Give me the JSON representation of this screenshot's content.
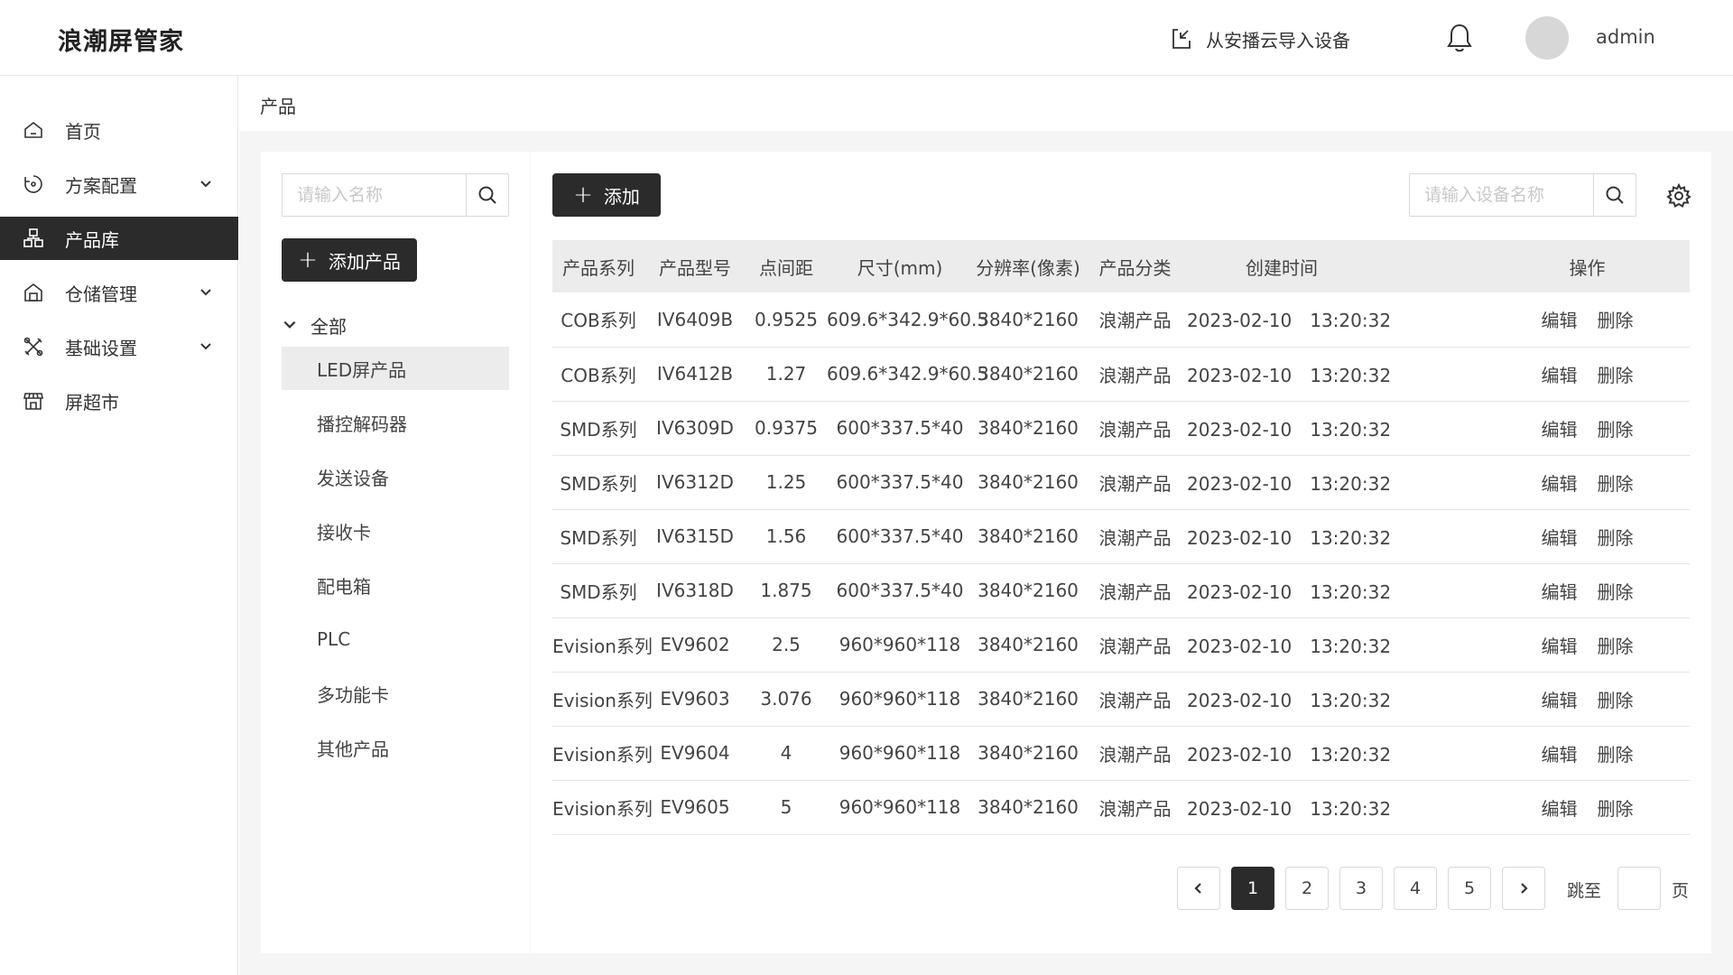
{
  "app": {
    "title": "浪潮屏管家"
  },
  "header": {
    "import_label": "从安播云导入设备",
    "username": "admin"
  },
  "sidebar": {
    "items": [
      {
        "label": "首页",
        "icon": "home-icon",
        "expandable": false
      },
      {
        "label": "方案配置",
        "icon": "scheme-icon",
        "expandable": true
      },
      {
        "label": "产品库",
        "icon": "product-library-icon",
        "expandable": false,
        "active": true
      },
      {
        "label": "仓储管理",
        "icon": "warehouse-icon",
        "expandable": true
      },
      {
        "label": "基础设置",
        "icon": "tools-icon",
        "expandable": true
      },
      {
        "label": "屏超市",
        "icon": "store-icon",
        "expandable": false
      }
    ]
  },
  "breadcrumb": "产品",
  "left_panel": {
    "search_placeholder": "请输入名称",
    "add_product_label": "添加产品",
    "tree_root": "全部",
    "categories": [
      "LED屏产品",
      "播控解码器",
      "发送设备",
      "接收卡",
      "配电箱",
      "PLC",
      "多功能卡",
      "其他产品"
    ],
    "selected_index": 0
  },
  "right_panel": {
    "add_label": "添加",
    "search_placeholder": "请输入设备名称"
  },
  "table": {
    "columns": [
      "产品系列",
      "产品型号",
      "点间距",
      "尺寸(mm)",
      "分辨率(像素)",
      "产品分类",
      "创建时间",
      "操作"
    ],
    "edit_label": "编辑",
    "delete_label": "删除",
    "rows": [
      [
        "COB系列",
        "IV6409B",
        "0.9525",
        "609.6*342.9*60.5",
        "3840*2160",
        "浪潮产品",
        "2023-02-10　13:20:32"
      ],
      [
        "COB系列",
        "IV6412B",
        "1.27",
        "609.6*342.9*60.5",
        "3840*2160",
        "浪潮产品",
        "2023-02-10　13:20:32"
      ],
      [
        "SMD系列",
        "IV6309D",
        "0.9375",
        "600*337.5*40",
        "3840*2160",
        "浪潮产品",
        "2023-02-10　13:20:32"
      ],
      [
        "SMD系列",
        "IV6312D",
        "1.25",
        "600*337.5*40",
        "3840*2160",
        "浪潮产品",
        "2023-02-10　13:20:32"
      ],
      [
        "SMD系列",
        "IV6315D",
        "1.56",
        "600*337.5*40",
        "3840*2160",
        "浪潮产品",
        "2023-02-10　13:20:32"
      ],
      [
        "SMD系列",
        "IV6318D",
        "1.875",
        "600*337.5*40",
        "3840*2160",
        "浪潮产品",
        "2023-02-10　13:20:32"
      ],
      [
        "Evision系列",
        "EV9602",
        "2.5",
        "960*960*118",
        "3840*2160",
        "浪潮产品",
        "2023-02-10　13:20:32"
      ],
      [
        "Evision系列",
        "EV9603",
        "3.076",
        "960*960*118",
        "3840*2160",
        "浪潮产品",
        "2023-02-10　13:20:32"
      ],
      [
        "Evision系列",
        "EV9604",
        "4",
        "960*960*118",
        "3840*2160",
        "浪潮产品",
        "2023-02-10　13:20:32"
      ],
      [
        "Evision系列",
        "EV9605",
        "5",
        "960*960*118",
        "3840*2160",
        "浪潮产品",
        "2023-02-10　13:20:32"
      ]
    ]
  },
  "pagination": {
    "pages": [
      "1",
      "2",
      "3",
      "4",
      "5"
    ],
    "current": "1",
    "jump_label": "跳至",
    "page_suffix": "页"
  },
  "colors": {
    "accent_dark": "#2b2b2b",
    "content_bg": "#f5f5f5",
    "table_header_bg": "#ececec"
  }
}
